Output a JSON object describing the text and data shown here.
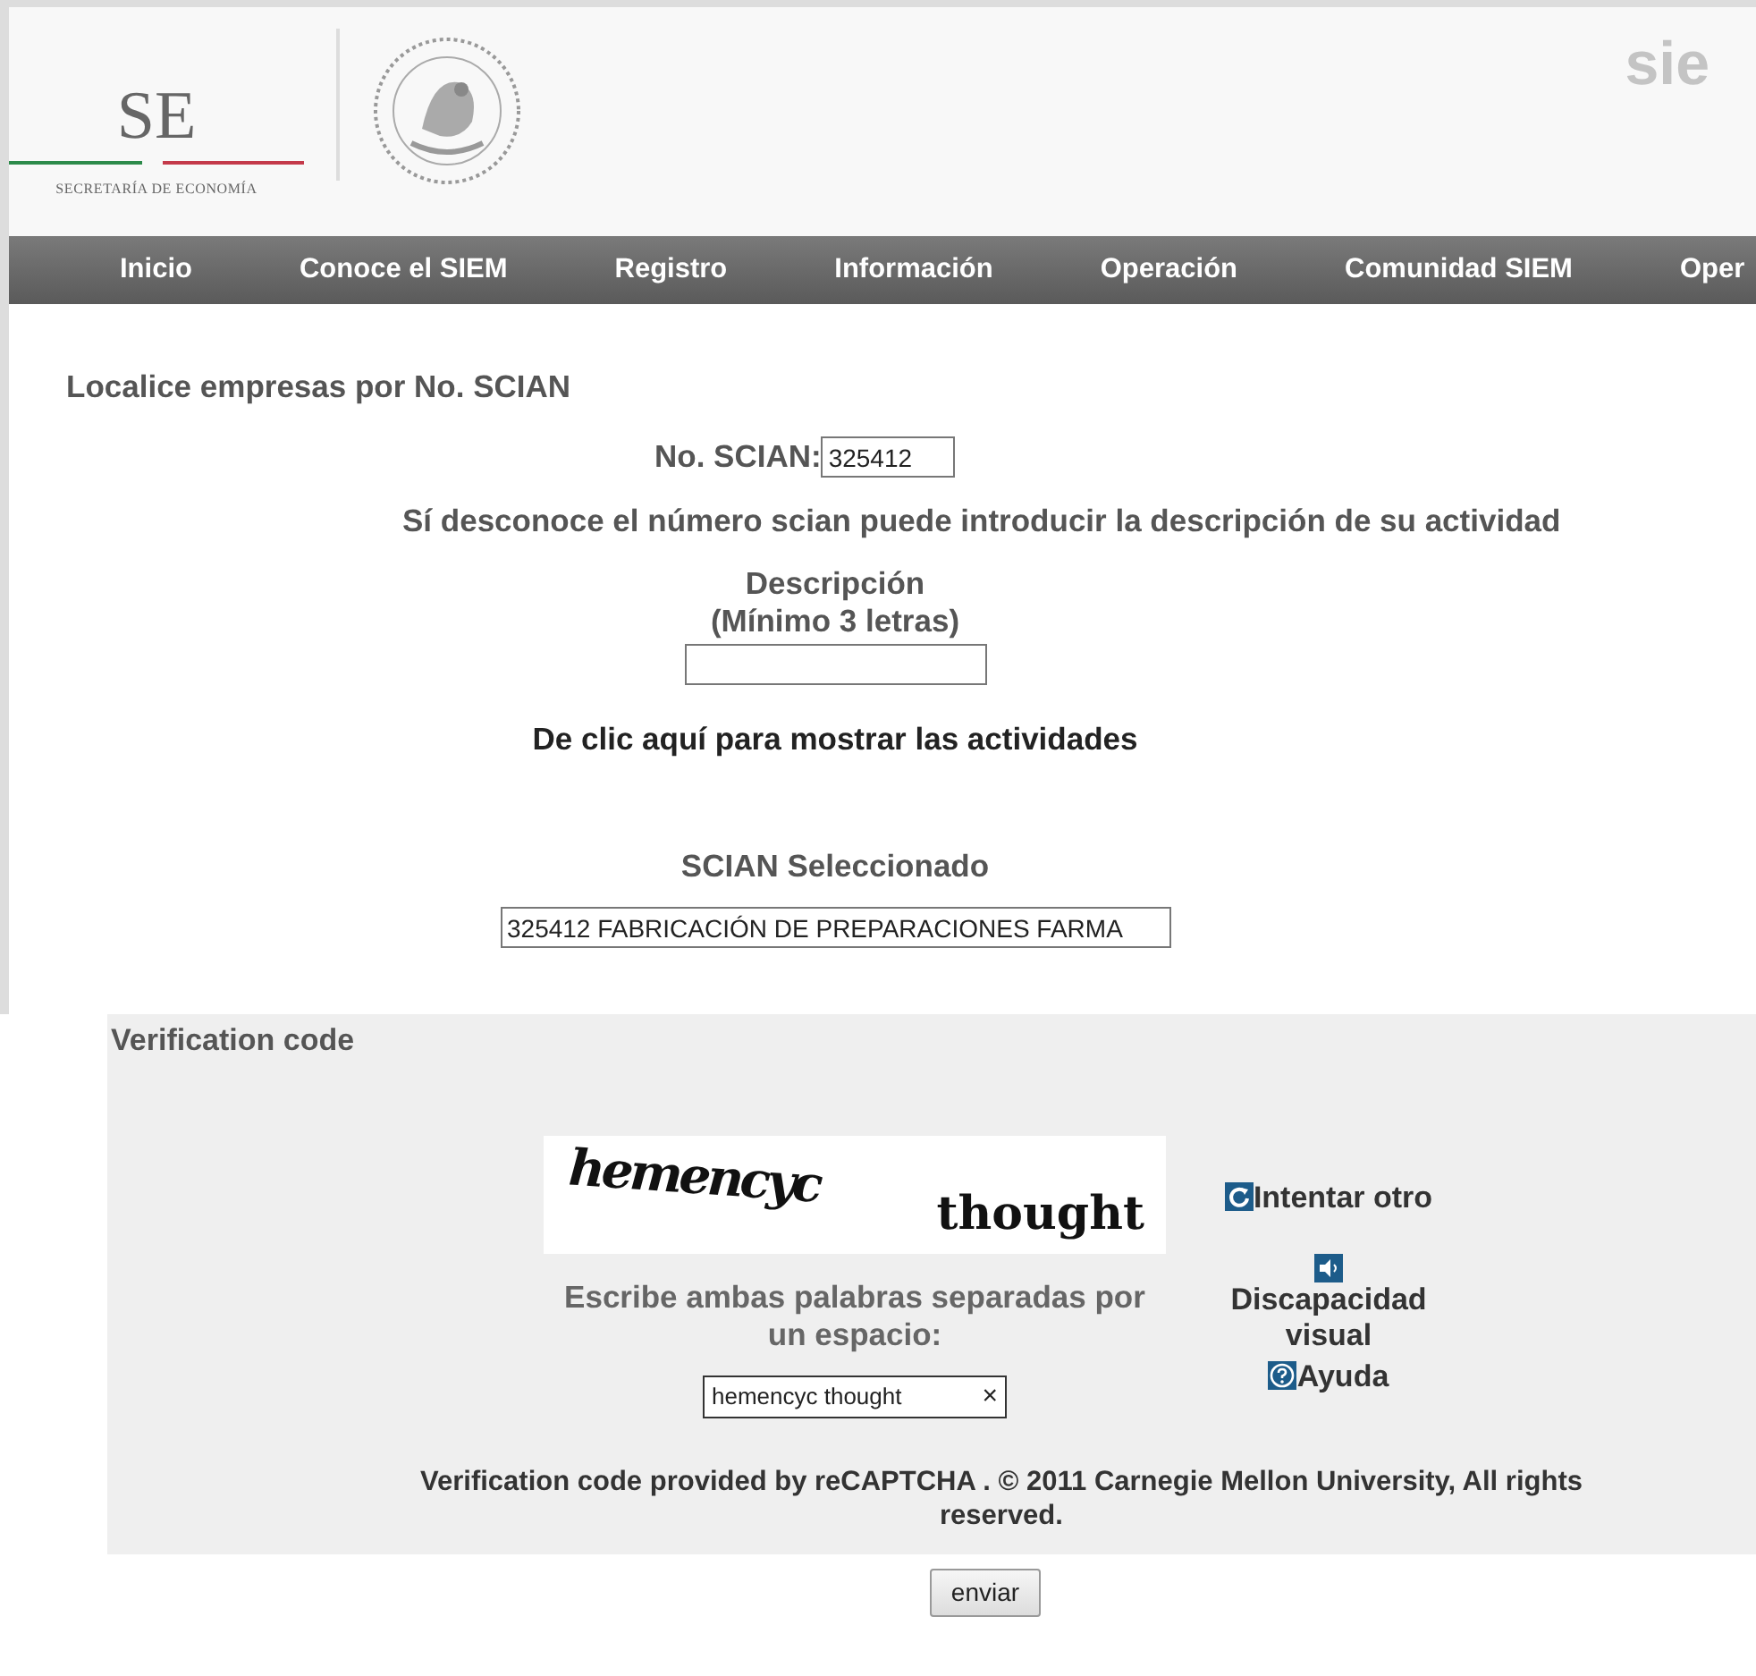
{
  "header": {
    "logo_letters": "SE",
    "logo_caption": "SECRETARÍA DE ECONOMÍA",
    "site_mark": "sie"
  },
  "nav": [
    {
      "label": "Inicio"
    },
    {
      "label": "Conoce el SIEM"
    },
    {
      "label": "Registro"
    },
    {
      "label": "Información"
    },
    {
      "label": "Operación"
    },
    {
      "label": "Comunidad SIEM"
    },
    {
      "label": "Oper"
    }
  ],
  "search": {
    "title": "Localice empresas por No. SCIAN",
    "scian_label": "No. SCIAN:",
    "scian_value": "325412",
    "hint": "Sí desconoce el número scian puede introducir la descripción de su actividad",
    "description_label": "Descripción",
    "description_note": "(Mínimo 3 letras)",
    "show_link": "De clic aquí para mostrar las actividades",
    "selected_label": "SCIAN Seleccionado",
    "selected_value": "325412 FABRICACIÓN DE PREPARACIONES FARMA"
  },
  "verification": {
    "title": "Verification code",
    "captcha_words": [
      "hemencyc",
      "thought"
    ],
    "retry": "Intentar otro",
    "audio": "Discapacidad visual",
    "help": "Ayuda",
    "instruction": "Escribe ambas palabras separadas por un espacio:",
    "answer_value": "hemencyc thought",
    "clear": "×",
    "credit": "Verification code provided by reCAPTCHA . © 2011 Carnegie Mellon University, All rights reserved."
  },
  "submit": "enviar"
}
